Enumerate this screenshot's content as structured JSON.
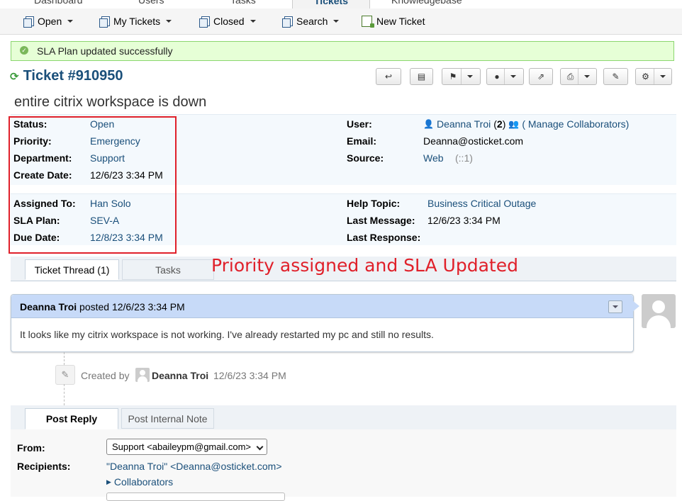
{
  "nav": {
    "tabs": [
      "Dashboard",
      "Users",
      "Tasks",
      "Tickets",
      "Knowledgebase"
    ]
  },
  "subnav": {
    "open": "Open",
    "my_tickets": "My Tickets",
    "closed": "Closed",
    "search": "Search",
    "new_ticket": "New Ticket"
  },
  "alert": {
    "message": "SLA Plan updated successfully"
  },
  "ticket": {
    "title": "Ticket #910950",
    "subject": "entire citrix workspace is down"
  },
  "info": {
    "status_label": "Status:",
    "status": "Open",
    "priority_label": "Priority:",
    "priority": "Emergency",
    "department_label": "Department:",
    "department": "Support",
    "create_date_label": "Create Date:",
    "create_date": "12/6/23 3:34 PM",
    "user_label": "User:",
    "user_name": "Deanna Troi",
    "user_count_open": "(",
    "user_count": "2",
    "user_count_close": ")",
    "manage_collaborators": "( Manage Collaborators)",
    "email_label": "Email:",
    "email": "Deanna@osticket.com",
    "source_label": "Source:",
    "source": "Web",
    "source_ip": "(::1)",
    "assigned_label": "Assigned To:",
    "assigned": "Han Solo",
    "sla_label": "SLA Plan:",
    "sla": "SEV-A",
    "due_label": "Due Date:",
    "due": "12/8/23 3:34 PM",
    "help_topic_label": "Help Topic:",
    "help_topic": "Business Critical Outage",
    "last_message_label": "Last Message:",
    "last_message": "12/6/23 3:34 PM",
    "last_response_label": "Last Response:"
  },
  "annotation": "Priority assigned and SLA Updated",
  "thread_tabs": {
    "thread": "Ticket Thread (1)",
    "tasks": "Tasks"
  },
  "entry": {
    "author": "Deanna Troi",
    "posted": "posted 12/6/23 3:34 PM",
    "body": "It looks like my citrix workspace is not working. I've already restarted my pc and still no results."
  },
  "event": {
    "created_by": "Created by",
    "author": "Deanna Troi",
    "time": "12/6/23 3:34 PM"
  },
  "reply_tabs": {
    "post_reply": "Post Reply",
    "internal_note": "Post Internal Note"
  },
  "reply": {
    "from_label": "From:",
    "from_value": "Support <abaileypm@gmail.com>",
    "recipients_label": "Recipients:",
    "recipients_value": "\"Deanna Troi\" <Deanna@osticket.com>",
    "collaborators": "Collaborators"
  },
  "colors": {
    "accent": "#1a4f7a",
    "highlight": "#e0202a",
    "success_bg": "#e6ffd6"
  }
}
